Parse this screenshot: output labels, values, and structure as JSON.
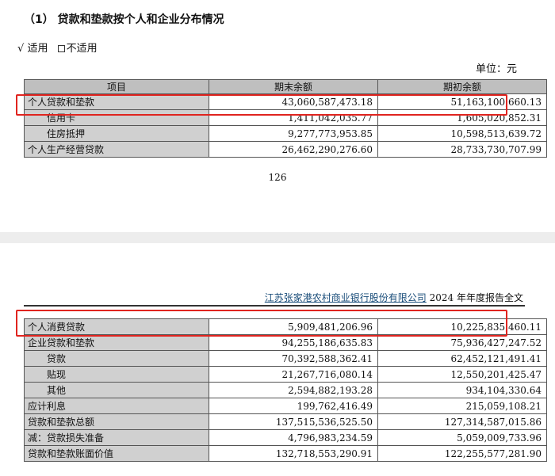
{
  "heading": "（1） 贷款和垫款按个人和企业分布情况",
  "applicability": {
    "check": "√",
    "applicable": "适用",
    "not_applicable": "不适用"
  },
  "unit": "单位：元",
  "table_header": {
    "item": "项目",
    "end": "期末余额",
    "begin": "期初余额"
  },
  "rows_top": [
    {
      "label": "个人贷款和垫款",
      "end": "43,060,587,473.18",
      "begin": "51,163,100,660.13",
      "indent": false
    },
    {
      "label": "信用卡",
      "end": "1,411,042,035.77",
      "begin": "1,605,020,852.31",
      "indent": true
    },
    {
      "label": "住房抵押",
      "end": "9,277,773,953.85",
      "begin": "10,598,513,639.72",
      "indent": true
    },
    {
      "label": "个人生产经营贷款",
      "end": "26,462,290,276.60",
      "begin": "28,733,730,707.99",
      "indent": false
    }
  ],
  "page_number": "126",
  "running_header": {
    "company": "江苏张家港农村商业银行股份有限公司",
    "report": "2024 年年度报告全文"
  },
  "rows_bottom": [
    {
      "label": "个人消费贷款",
      "end": "5,909,481,206.96",
      "begin": "10,225,835,460.11",
      "indent": false
    },
    {
      "label": "企业贷款和垫款",
      "end": "94,255,186,635.83",
      "begin": "75,936,427,247.52",
      "indent": false
    },
    {
      "label": "贷款",
      "end": "70,392,588,362.41",
      "begin": "62,452,121,491.41",
      "indent": true
    },
    {
      "label": "贴现",
      "end": "21,267,716,080.14",
      "begin": "12,550,201,425.47",
      "indent": true
    },
    {
      "label": "其他",
      "end": "2,594,882,193.28",
      "begin": "934,104,330.64",
      "indent": true
    },
    {
      "label": "应计利息",
      "end": "199,762,416.49",
      "begin": "215,059,108.21",
      "indent": false
    },
    {
      "label": "贷款和垫款总额",
      "end": "137,515,536,525.50",
      "begin": "127,314,587,015.86",
      "indent": false
    },
    {
      "label": "减：贷款损失准备",
      "end": "4,796,983,234.59",
      "begin": "5,059,009,733.96",
      "indent": false
    },
    {
      "label": "贷款和垫款账面价值",
      "end": "132,718,553,290.91",
      "begin": "122,255,577,281.90",
      "indent": false
    }
  ]
}
